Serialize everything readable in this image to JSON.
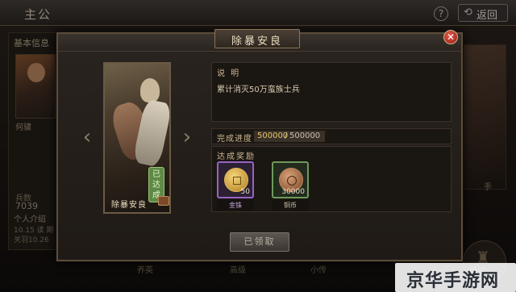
{
  "screen": {
    "title": "主公",
    "help_glyph": "?",
    "back_label": "返回",
    "sidebar_section": "基本信息",
    "hero_name": "何骕",
    "stat_label": "兵数",
    "stat_value": "7039",
    "bio_title": "个人介绍",
    "bio_line1": "10.15 读 期",
    "bio_line2": "关羽10.26",
    "right_label": "手",
    "tabs": [
      "养英",
      "高级",
      "小传"
    ],
    "castle_label": "城池"
  },
  "dialog": {
    "title": "除暴安良",
    "close_glyph": "✕",
    "card": {
      "name": "除暴安良",
      "badge": "已达成"
    },
    "description_label": "说 明",
    "description": "累计消灭50万蛮族士兵",
    "progress_label": "完成进度",
    "progress_current": "500000",
    "progress_separator": "/",
    "progress_total": "500000",
    "progress_fraction": 1.0,
    "reward_title": "达成奖励",
    "rewards": [
      {
        "name": "金铢",
        "quantity": "50",
        "icon": "gold-coin-icon",
        "frame_color": "#9a62c4"
      },
      {
        "name": "铜币",
        "quantity": "30000",
        "icon": "copper-coin-icon",
        "frame_color": "#6e9a5c"
      }
    ],
    "claimed_button": "已领取"
  },
  "watermark": "京华手游网",
  "colors": {
    "accent_gold": "#e3c56d",
    "achieved_green": "#5d8a45",
    "close_red": "#c8372a"
  }
}
